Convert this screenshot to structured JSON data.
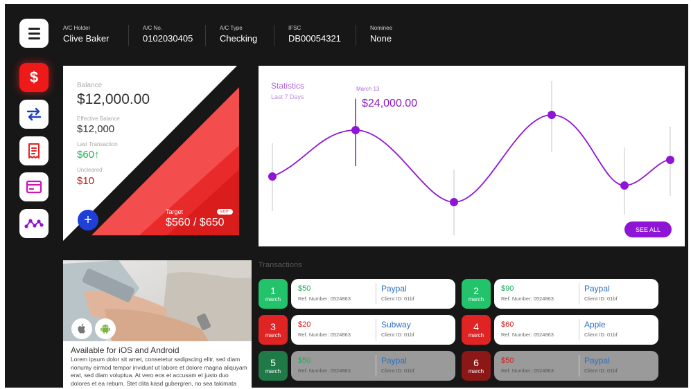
{
  "header": {
    "fields": [
      {
        "label": "A/C Holder",
        "value": "Clive Baker"
      },
      {
        "label": "A/C No.",
        "value": "0102030405"
      },
      {
        "label": "A/C Type",
        "value": "Checking"
      },
      {
        "label": "IFSC",
        "value": "DB00054321"
      },
      {
        "label": "Nominee",
        "value": "None"
      }
    ]
  },
  "sidebar": {
    "items": [
      {
        "icon": "dollar-icon",
        "glyph": "$",
        "active": true
      },
      {
        "icon": "transfer-icon",
        "active": false
      },
      {
        "icon": "receipt-icon",
        "active": false
      },
      {
        "icon": "card-icon",
        "active": false
      },
      {
        "icon": "chart-icon",
        "active": false
      }
    ]
  },
  "balance": {
    "balance_label": "Balance",
    "balance_value": "$12,000.00",
    "effective_label": "Effective Balance",
    "effective_value": "$12,000",
    "last_tx_label": "Last Transaction",
    "last_tx_value": "$60",
    "last_tx_arrow": "↑",
    "uncleared_label": "Uncleared",
    "uncleared_value": "$10",
    "add_glyph": "+",
    "target_label": "Target",
    "edit_label": "EDIT",
    "target_value": "$560 / $650"
  },
  "stats": {
    "title": "Statistics",
    "subtitle": "Last 7 Days",
    "highlight_date": "March 13",
    "highlight_value": "$24,000.00",
    "see_all_label": "SEE ALL",
    "accent": "#9b1fe0"
  },
  "app_promo": {
    "title": "Available for iOS and Android",
    "body": "Lorem ipsum dolor sit amet, consetetur sadipscing elitr, sed diam nonumy eirmod tempor invidunt ut labore et dolore magna aliquyam erat, sed diam voluptua. At vero eos et accusam et justo duo dolores et ea rebum. Stet clita kasd gubergren, no sea takimata sanctus est"
  },
  "transactions": {
    "title": "Transactions",
    "ref_prefix": "Ref. Number: ",
    "client_prefix": "Client ID: ",
    "items": [
      {
        "day": "1",
        "month": "march",
        "amount": "$50",
        "ref": "0524863",
        "name": "Paypal",
        "client": "01bf",
        "type": "credit"
      },
      {
        "day": "2",
        "month": "march",
        "amount": "$90",
        "ref": "0524863",
        "name": "Paypal",
        "client": "01bf",
        "type": "credit"
      },
      {
        "day": "3",
        "month": "march",
        "amount": "$20",
        "ref": "0524863",
        "name": "Subway",
        "client": "01bf",
        "type": "debit"
      },
      {
        "day": "4",
        "month": "march",
        "amount": "$60",
        "ref": "0524863",
        "name": "Apple",
        "client": "01bf",
        "type": "debit"
      },
      {
        "day": "5",
        "month": "march",
        "amount": "$50",
        "ref": "0524863",
        "name": "Paypal",
        "client": "01bf",
        "type": "credit",
        "dimmed": true
      },
      {
        "day": "6",
        "month": "march",
        "amount": "$50",
        "ref": "0524863",
        "name": "Paypal",
        "client": "01bf",
        "type": "debit",
        "dimmed": true
      }
    ]
  },
  "colors": {
    "credit": "#22c36b",
    "debit": "#e02424",
    "credit_dim": "#1f7a47",
    "debit_dim": "#8c1717",
    "credit_text": "#1fae55",
    "debit_text": "#d81c1c"
  }
}
